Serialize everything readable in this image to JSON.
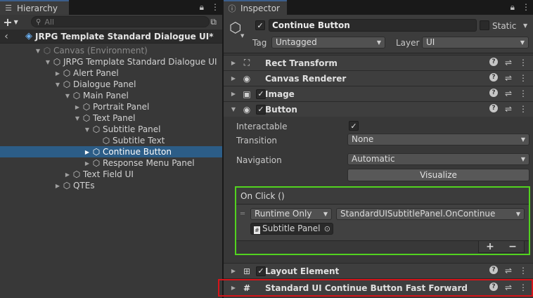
{
  "hierarchy": {
    "tab_title": "Hierarchy",
    "search_placeholder": "All",
    "scene_name": "JRPG Template Standard Dialogue UI*",
    "items": [
      {
        "label": "Canvas (Environment)"
      },
      {
        "label": "JRPG Template Standard Dialogue UI"
      },
      {
        "label": "Alert Panel"
      },
      {
        "label": "Dialogue Panel"
      },
      {
        "label": "Main Panel"
      },
      {
        "label": "Portrait Panel"
      },
      {
        "label": "Text Panel"
      },
      {
        "label": "Subtitle Panel"
      },
      {
        "label": "Subtitle Text"
      },
      {
        "label": "Continue Button"
      },
      {
        "label": "Response Menu Panel"
      },
      {
        "label": "Text Field UI"
      },
      {
        "label": "QTEs"
      }
    ],
    "selected_item": "Continue Button"
  },
  "inspector": {
    "tab_title": "Inspector",
    "object_name": "Continue Button",
    "static_label": "Static",
    "tag_label": "Tag",
    "tag_value": "Untagged",
    "layer_label": "Layer",
    "layer_value": "UI",
    "components": {
      "rect_transform": "Rect Transform",
      "canvas_renderer": "Canvas Renderer",
      "image": "Image",
      "button": "Button",
      "layout_element": "Layout Element",
      "fast_forward": "Standard UI Continue Button Fast Forward"
    },
    "button": {
      "interactable_label": "Interactable",
      "transition_label": "Transition",
      "transition_value": "None",
      "navigation_label": "Navigation",
      "navigation_value": "Automatic",
      "visualize_label": "Visualize"
    },
    "on_click": {
      "header": "On Click ()",
      "runtime_value": "Runtime Only",
      "function_value": "StandardUISubtitlePanel.OnContinue",
      "target_object": "Subtitle Panel",
      "add_label": "+",
      "remove_label": "−"
    }
  },
  "colors": {
    "selection": "#2c5d87",
    "highlight_green": "#52d31f",
    "highlight_red": "#d6141a",
    "scene_icon": "#6ab0f3"
  }
}
